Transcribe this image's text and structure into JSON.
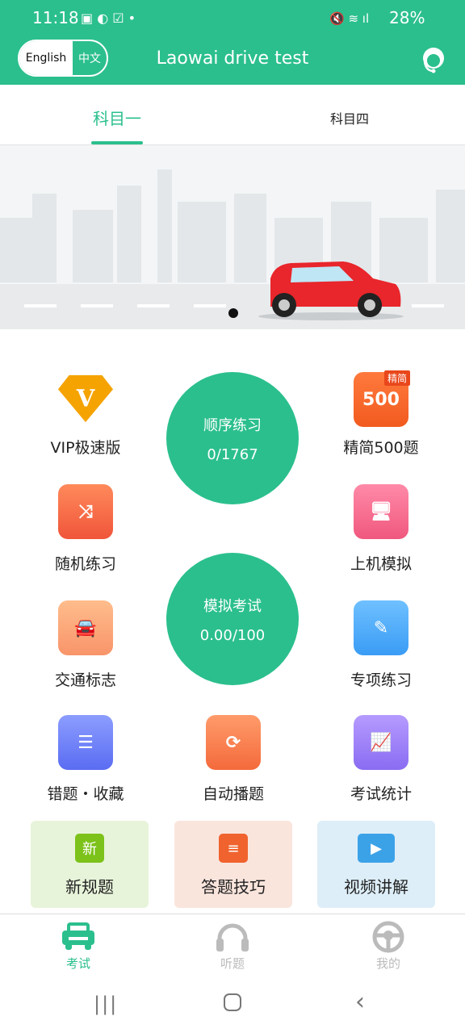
{
  "status_bar": {
    "time": "11:18",
    "battery": "28%"
  },
  "header": {
    "lang_english": "English",
    "lang_chinese": "中文",
    "title": "Laowai drive test"
  },
  "tabs": [
    {
      "label": "科目一",
      "active": true
    },
    {
      "label": "科目四",
      "active": false
    }
  ],
  "grid": {
    "vip": "VIP极速版",
    "simplified": "精简500题",
    "simplified_badge": "精简",
    "simplified_num": "500",
    "random": "随机练习",
    "computer_sim": "上机模拟",
    "traffic_signs": "交通标志",
    "special": "专项练习",
    "wrong_fav": "错题・收藏",
    "autoplay": "自动播题",
    "stats": "考试统计"
  },
  "sequential": {
    "label": "顺序练习",
    "progress": "0/1767"
  },
  "mock_exam": {
    "label": "模拟考试",
    "score": "0.00/100"
  },
  "tiles": [
    {
      "label": "新规题",
      "icon_text": "新"
    },
    {
      "label": "答题技巧"
    },
    {
      "label": "视频讲解"
    }
  ],
  "bottom_nav": [
    {
      "label": "考试",
      "active": true
    },
    {
      "label": "听题"
    },
    {
      "label": "我的"
    }
  ],
  "colors": {
    "accent": "#2bbf8e",
    "inactive": "#bbbbbb"
  }
}
